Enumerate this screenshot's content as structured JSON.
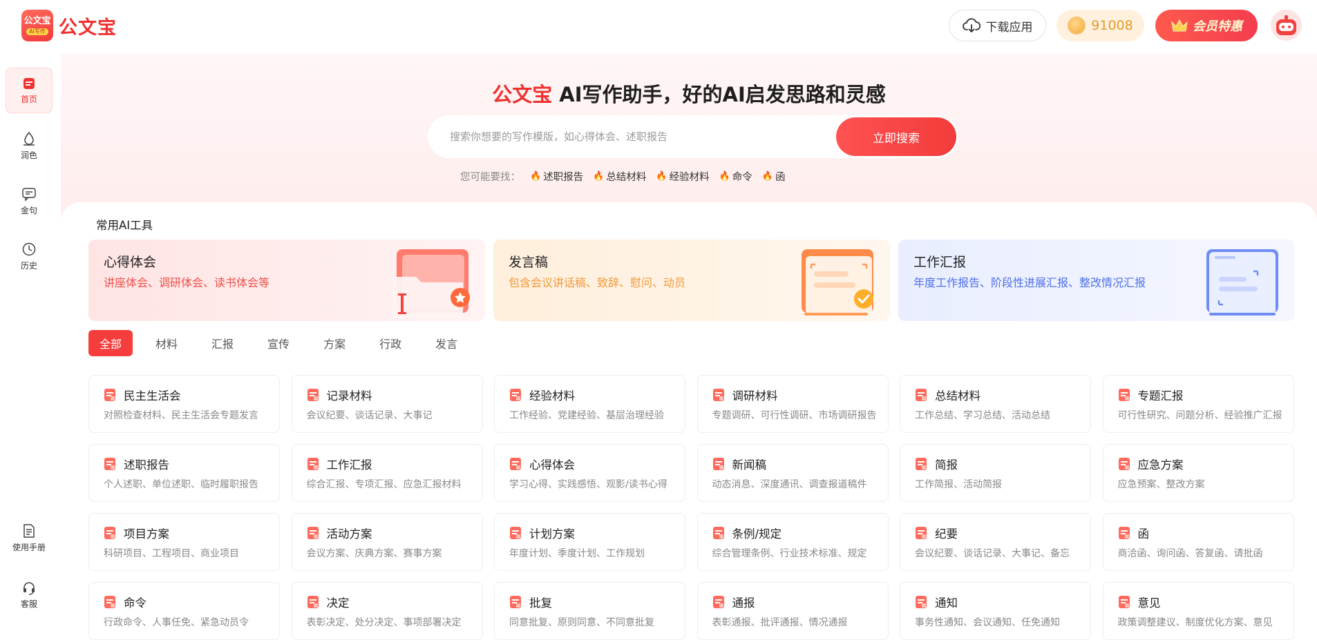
{
  "header": {
    "logo_badge_line1": "公文宝",
    "logo_badge_line2": "AI写作",
    "logo_text": "公文宝",
    "download_label": "下载应用",
    "coins": "91008",
    "vip_label": "会员特惠"
  },
  "sidebar": {
    "items": [
      {
        "label": "首页",
        "icon": "home-icon"
      },
      {
        "label": "润色",
        "icon": "polish-icon"
      },
      {
        "label": "金句",
        "icon": "quote-icon"
      },
      {
        "label": "历史",
        "icon": "clock-icon"
      }
    ],
    "bottom": [
      {
        "label": "使用手册",
        "icon": "manual-icon"
      },
      {
        "label": "客服",
        "icon": "headset-icon"
      }
    ]
  },
  "hero": {
    "brand": "公文宝",
    "title": "AI写作助手，好的AI启发思路和灵感",
    "search_placeholder": "搜索你想要的写作模版，如心得体会、述职报告",
    "search_button": "立即搜索",
    "suggest_label": "您可能要找：",
    "suggestions": [
      "述职报告",
      "总结材料",
      "经验材料",
      "命令",
      "函"
    ]
  },
  "tools": {
    "section_title": "常用AI工具",
    "cards": [
      {
        "title": "心得体会",
        "desc": "讲座体会、调研体会、读书体会等"
      },
      {
        "title": "发言稿",
        "desc": "包含会议讲话稿、致辞、慰问、动员"
      },
      {
        "title": "工作汇报",
        "desc": "年度工作报告、阶段性进展汇报、整改情况汇报"
      }
    ]
  },
  "tabs": [
    "全部",
    "材料",
    "汇报",
    "宣传",
    "方案",
    "行政",
    "发言"
  ],
  "categories": [
    {
      "title": "民主生活会",
      "desc": "对照检查材料、民主生活会专题发言"
    },
    {
      "title": "记录材料",
      "desc": "会议纪要、谈话记录、大事记"
    },
    {
      "title": "经验材料",
      "desc": "工作经验、党建经验、基层治理经验"
    },
    {
      "title": "调研材料",
      "desc": "专题调研、可行性调研、市场调研报告"
    },
    {
      "title": "总结材料",
      "desc": "工作总结、学习总结、活动总结"
    },
    {
      "title": "专题汇报",
      "desc": "可行性研究、问题分析、经验推广汇报"
    },
    {
      "title": "述职报告",
      "desc": "个人述职、单位述职、临时履职报告"
    },
    {
      "title": "工作汇报",
      "desc": "综合汇报、专项汇报、应急汇报材料"
    },
    {
      "title": "心得体会",
      "desc": "学习心得、实践感悟、观影/读书心得"
    },
    {
      "title": "新闻稿",
      "desc": "动态消息、深度通讯、调查报道稿件"
    },
    {
      "title": "简报",
      "desc": "工作简报、活动简报"
    },
    {
      "title": "应急方案",
      "desc": "应急预案、整改方案"
    },
    {
      "title": "项目方案",
      "desc": "科研项目、工程项目、商业项目"
    },
    {
      "title": "活动方案",
      "desc": "会议方案、庆典方案、赛事方案"
    },
    {
      "title": "计划方案",
      "desc": "年度计划、季度计划、工作规划"
    },
    {
      "title": "条例/规定",
      "desc": "综合管理条例、行业技术标准、规定"
    },
    {
      "title": "纪要",
      "desc": "会议纪要、谈话记录、大事记、备忘"
    },
    {
      "title": "函",
      "desc": "商洽函、询问函、答复函、请批函"
    },
    {
      "title": "命令",
      "desc": "行政命令、人事任免、紧急动员令"
    },
    {
      "title": "决定",
      "desc": "表彰决定、处分决定、事项部署决定"
    },
    {
      "title": "批复",
      "desc": "同意批复、原则同意、不同意批复"
    },
    {
      "title": "通报",
      "desc": "表彰通报、批评通报、情况通报"
    },
    {
      "title": "通知",
      "desc": "事务性通知、会议通知、任免通知"
    },
    {
      "title": "意见",
      "desc": "政策调整建议、制度优化方案、意见"
    }
  ]
}
